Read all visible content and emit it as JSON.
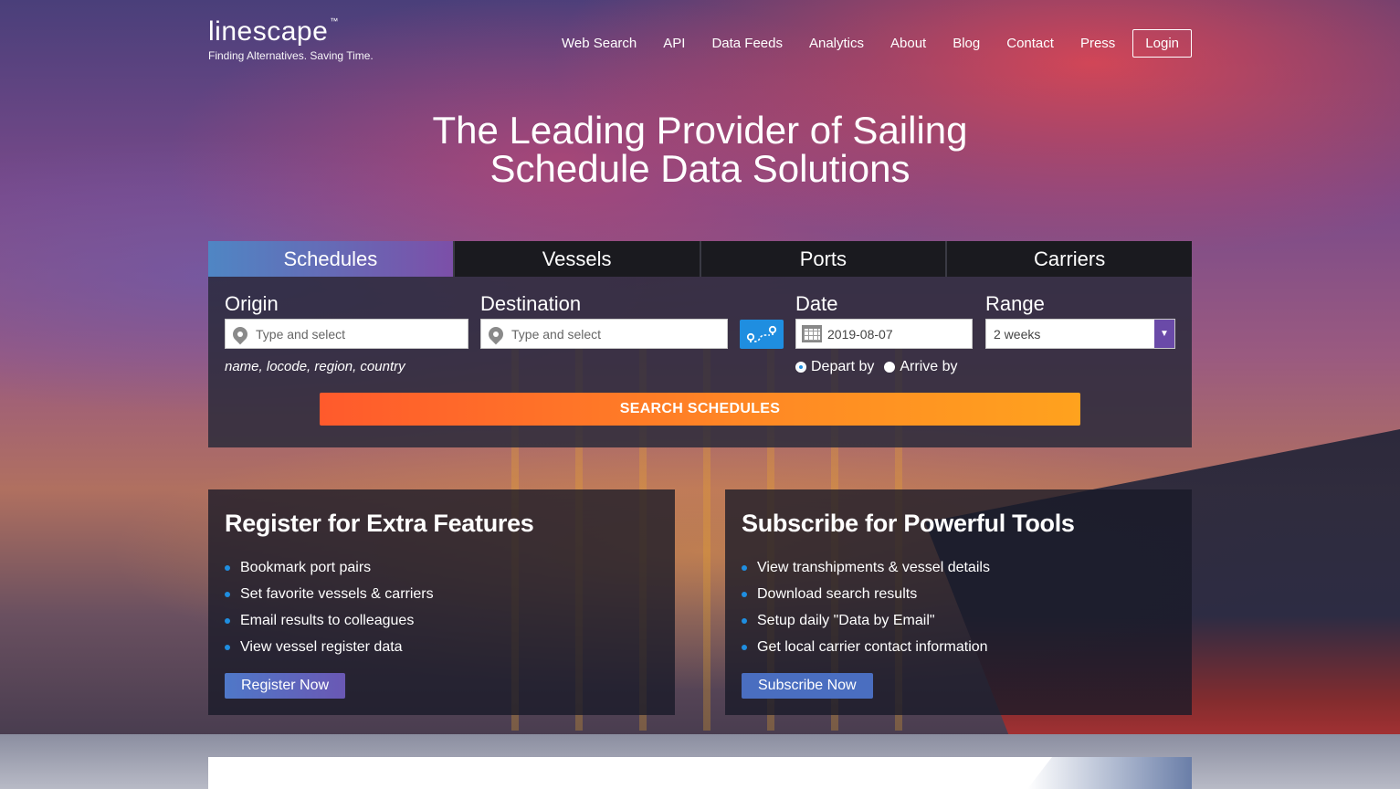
{
  "brand": {
    "name": "linescape",
    "tm": "™",
    "tagline": "Finding Alternatives. Saving Time."
  },
  "nav": {
    "items": [
      "Web Search",
      "API",
      "Data Feeds",
      "Analytics",
      "About",
      "Blog",
      "Contact",
      "Press"
    ],
    "login": "Login"
  },
  "hero": {
    "line1": "The Leading Provider of Sailing",
    "line2": "Schedule Data Solutions"
  },
  "tabs": [
    "Schedules",
    "Vessels",
    "Ports",
    "Carriers"
  ],
  "form": {
    "origin_label": "Origin",
    "origin_placeholder": "Type and select",
    "destination_label": "Destination",
    "destination_placeholder": "Type and select",
    "hint": "name, locode, region, country",
    "date_label": "Date",
    "date_value": "2019-08-07",
    "range_label": "Range",
    "range_value": "2 weeks",
    "depart_by": "Depart by",
    "arrive_by": "Arrive by",
    "selected_mode": "Depart by",
    "search_button": "SEARCH SCHEDULES"
  },
  "register": {
    "title": "Register for Extra Features",
    "items": [
      "Bookmark port pairs",
      "Set favorite vessels & carriers",
      "Email results to colleagues",
      "View vessel register data"
    ],
    "button": "Register Now"
  },
  "subscribe": {
    "title": "Subscribe for Powerful Tools",
    "items": [
      "View transhipments & vessel details",
      "Download search results",
      "Setup daily \"Data by Email\"",
      "Get local carrier contact information"
    ],
    "button": "Subscribe Now"
  },
  "colors": {
    "accent_blue": "#1f8ee0",
    "search_orange": "#ff7a28",
    "range_purple": "#6a4aa8"
  }
}
